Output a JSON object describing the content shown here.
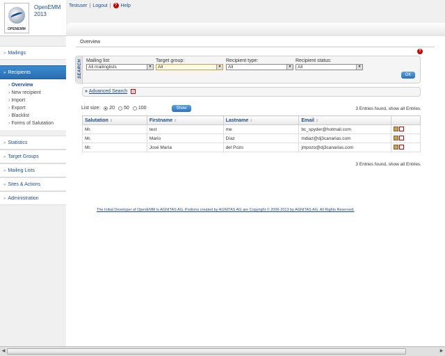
{
  "header": {
    "app_name_line1": "OpenEMM",
    "app_name_line2": "2013",
    "logo_text": "OPENEMM",
    "user": "Testuser",
    "sep1": "|",
    "logout": "Logout",
    "sep2": "|",
    "help": "Help"
  },
  "sidebar": {
    "items": [
      {
        "label": "Mailings"
      },
      {
        "label": "Recipients"
      },
      {
        "label": "Statistics"
      },
      {
        "label": "Target Groups"
      },
      {
        "label": "Mailing Lists"
      },
      {
        "label": "Sites & Actions"
      },
      {
        "label": "Administration"
      }
    ],
    "sub_items": [
      {
        "label": "Overview"
      },
      {
        "label": "New recipient"
      },
      {
        "label": "Import"
      },
      {
        "label": "Export"
      },
      {
        "label": "Blacklist"
      },
      {
        "label": "Forms of Salutation"
      }
    ]
  },
  "main": {
    "tab": "Overview",
    "search_label": "SEARCH",
    "filters": [
      {
        "label": "Mailing list:",
        "value": "All mailinglists"
      },
      {
        "label": "Target group:",
        "value": "All"
      },
      {
        "label": "Recipient type:",
        "value": "All"
      },
      {
        "label": "Recipient status:",
        "value": "All"
      }
    ],
    "ok_label": "OK",
    "advanced_search": "Advanced Search",
    "list_size_label": "List size:",
    "list_sizes": [
      "20",
      "50",
      "100"
    ],
    "list_size_selected": "20",
    "show_label": "Show",
    "entries_found": "3 Entries found, show all Entries.",
    "columns": [
      "Salutation",
      "Firstname",
      "Lastname",
      "Email"
    ],
    "rows": [
      [
        "Mr.",
        "test",
        "me",
        "bc_spyder@hotmail.com"
      ],
      [
        "Mr.",
        "Mario",
        "Díaz",
        "mdiaz@dj3canarias.com"
      ],
      [
        "Mr.",
        "José María",
        "del Pozo",
        "jmpozo@dj3canarias.com"
      ]
    ],
    "footer": "The Initial Developer of OpenEMM is AGNITAS AG. Portions created by AGNITAS AG are Copyright © 2006-2013 by AGNITAS AG. All Rights Reserved."
  },
  "colors": {
    "accent": "#1a4d8c",
    "active_nav": "#2a6eb0",
    "help_red": "#cc0000"
  }
}
